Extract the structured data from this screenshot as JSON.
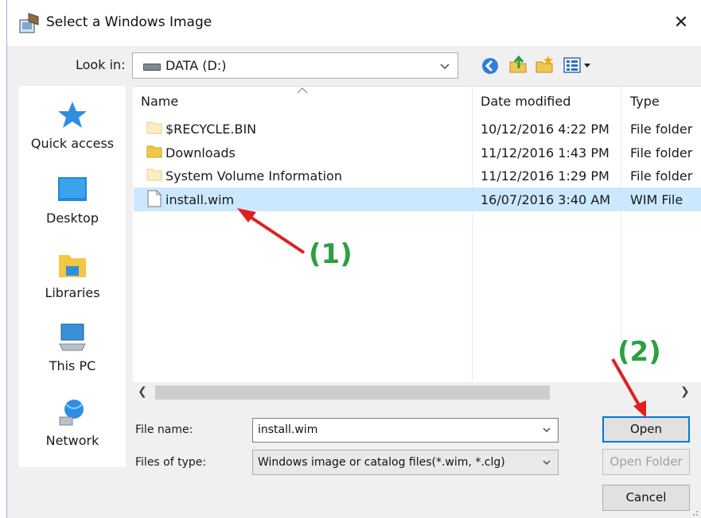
{
  "window": {
    "title": "Select a Windows Image",
    "close_glyph": "✕"
  },
  "lookin": {
    "label": "Look in:",
    "value": "DATA (D:)"
  },
  "toolbar": {
    "icons": [
      "back-icon",
      "up-folder-icon",
      "new-folder-icon",
      "view-menu-icon"
    ]
  },
  "places": [
    {
      "label": "Quick access",
      "icon": "star-icon"
    },
    {
      "label": "Desktop",
      "icon": "desktop-icon"
    },
    {
      "label": "Libraries",
      "icon": "libraries-icon"
    },
    {
      "label": "This PC",
      "icon": "computer-icon"
    },
    {
      "label": "Network",
      "icon": "network-icon"
    }
  ],
  "files": {
    "columns": [
      "Name",
      "Date modified",
      "Type"
    ],
    "rows": [
      {
        "name": "$RECYCLE.BIN",
        "date": "10/12/2016 4:22 PM",
        "type": "File folder",
        "icon": "folder-icon"
      },
      {
        "name": "Downloads",
        "date": "11/12/2016 1:43 PM",
        "type": "File folder",
        "icon": "folder-icon"
      },
      {
        "name": "System Volume Information",
        "date": "11/12/2016 1:29 PM",
        "type": "File folder",
        "icon": "folder-icon"
      },
      {
        "name": "install.wim",
        "date": "16/07/2016 3:40 AM",
        "type": "WIM File",
        "icon": "file-icon"
      }
    ]
  },
  "filename": {
    "label": "File name:",
    "value": "install.wim"
  },
  "filetype": {
    "label": "Files of type:",
    "value": "Windows image or catalog files(*.wim, *.clg)"
  },
  "buttons": {
    "open": "Open",
    "open_folder": "Open Folder",
    "cancel": "Cancel"
  },
  "annotations": {
    "step1": "(1)",
    "step2": "(2)",
    "color": "#2e9e43",
    "arrow_color": "#e02020"
  },
  "colors": {
    "selection": "#cce8ff",
    "accent": "#0078d7"
  }
}
